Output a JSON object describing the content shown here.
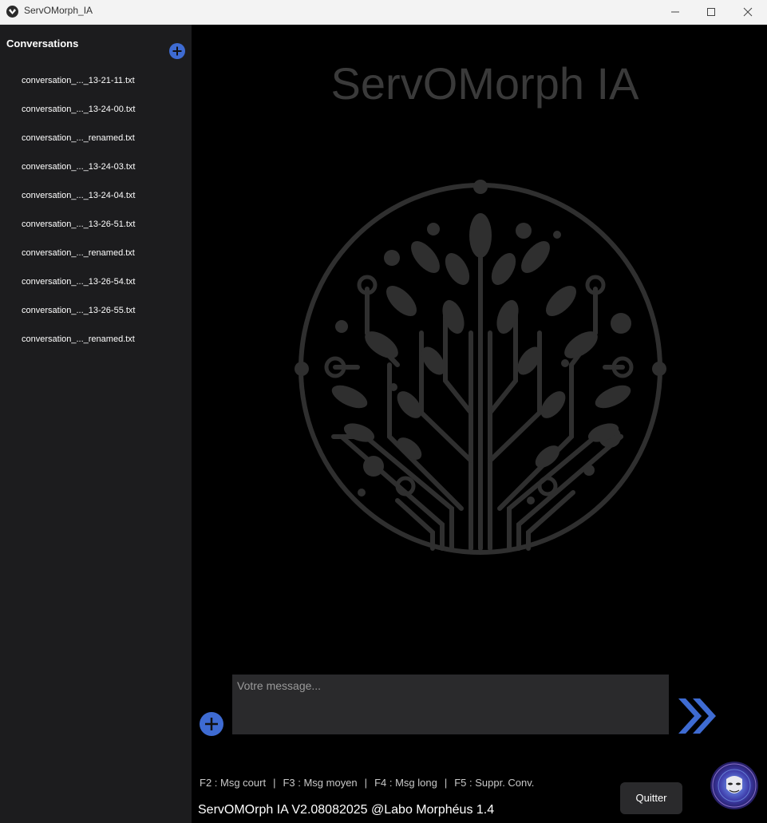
{
  "window": {
    "title": "ServOMorph_IA"
  },
  "sidebar": {
    "title": "Conversations",
    "add_icon": "plus-circle-icon",
    "items": [
      {
        "label": "conversation_..._13-21-11.txt"
      },
      {
        "label": "conversation_..._13-24-00.txt"
      },
      {
        "label": "conversation_..._renamed.txt"
      },
      {
        "label": "conversation_..._13-24-03.txt"
      },
      {
        "label": "conversation_..._13-24-04.txt"
      },
      {
        "label": "conversation_..._13-26-51.txt"
      },
      {
        "label": "conversation_..._renamed.txt"
      },
      {
        "label": "conversation_..._13-26-54.txt"
      },
      {
        "label": "conversation_..._13-26-55.txt"
      },
      {
        "label": "conversation_..._renamed.txt"
      }
    ]
  },
  "main": {
    "watermark_title": "ServOMorph IA",
    "logo_icon": "tree-circuit-logo",
    "input": {
      "placeholder": "Votre message...",
      "value": ""
    },
    "send_icon": "double-chevron-right-icon",
    "attach_icon": "plus-circle-icon"
  },
  "footer": {
    "shortcuts": [
      {
        "label": "F2 : Msg court"
      },
      {
        "label": "F3 : Msg moyen"
      },
      {
        "label": "F4 : Msg long"
      },
      {
        "label": "F5 : Suppr. Conv."
      }
    ],
    "separator": "|",
    "quit_label": "Quitter",
    "version": "ServOMOrph IA V2.08082025  @Labo Morphéus 1.4"
  },
  "colors": {
    "accent": "#3e6bd2",
    "sidebar_bg": "#1c1c1e",
    "main_bg": "#000000",
    "input_bg": "#2a2a2c",
    "watermark": "#3a3a3a"
  }
}
